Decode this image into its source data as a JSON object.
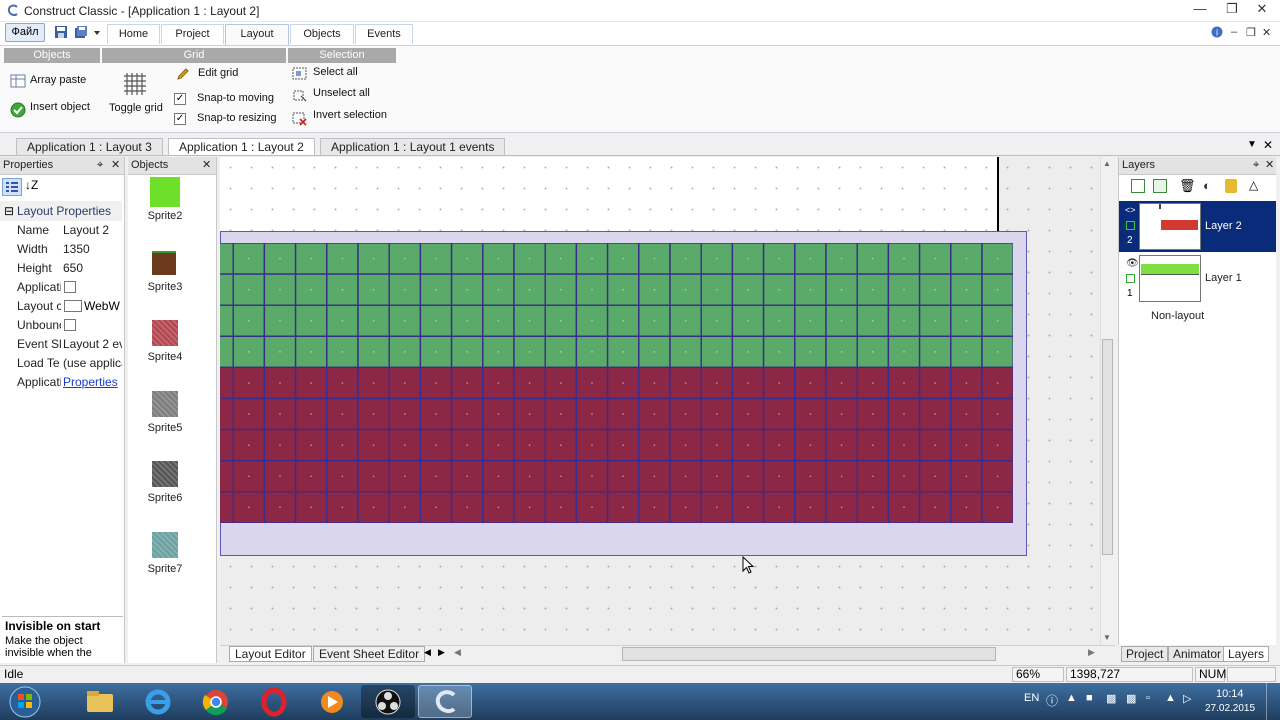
{
  "window": {
    "title": "Construct Classic - [Application 1 : Layout 2]"
  },
  "ribbon": {
    "file_label": "Файл",
    "tabs": [
      "Home",
      "Project",
      "Layout",
      "Objects",
      "Events"
    ],
    "active_tab": "Layout",
    "groups": {
      "objects": {
        "title": "Objects",
        "array_paste": "Array paste",
        "insert_object": "Insert object"
      },
      "grid": {
        "title": "Grid",
        "toggle_grid": "Toggle grid",
        "edit_grid": "Edit grid",
        "snap_moving": "Snap-to moving",
        "snap_resizing": "Snap-to resizing"
      },
      "selection": {
        "title": "Selection",
        "select_all": "Select all",
        "unselect_all": "Unselect all",
        "invert_selection": "Invert selection"
      }
    }
  },
  "doc_tabs": [
    "Application 1 : Layout 3",
    "Application 1 : Layout 2",
    "Application 1 : Layout 1 events"
  ],
  "properties": {
    "title": "Properties",
    "section": "Layout Properties",
    "rows": [
      {
        "key": "Name",
        "value": "Layout 2"
      },
      {
        "key": "Width",
        "value": "1350"
      },
      {
        "key": "Height",
        "value": "650"
      },
      {
        "key": "Applicati",
        "value": ""
      },
      {
        "key": "Layout c",
        "value": "WebW"
      },
      {
        "key": "Unbounc",
        "value": ""
      },
      {
        "key": "Event Sl",
        "value": "Layout 2 ev"
      },
      {
        "key": "Load Te",
        "value": "(use applica"
      },
      {
        "key": "Applicati",
        "value": "Properties"
      }
    ],
    "help_title": "Invisible on start",
    "help_text": "Make the object invisible when the"
  },
  "objects_panel": {
    "title": "Objects",
    "items": [
      {
        "name": "Sprite2",
        "color": "#6fe02a"
      },
      {
        "name": "Sprite3",
        "color": "#6b3a1f"
      },
      {
        "name": "Sprite4",
        "color": "#b3454f"
      },
      {
        "name": "Sprite5",
        "color": "#7d7d7d"
      },
      {
        "name": "Sprite6",
        "color": "#555555"
      },
      {
        "name": "Sprite7",
        "color": "#6aa0a0"
      }
    ]
  },
  "editor": {
    "tiles": {
      "green": "#5aaa69",
      "red": "#8c2846",
      "border": "#3a2c8c",
      "green_rows": 4,
      "red_rows": 5,
      "cols": 26
    },
    "bottom_tabs": [
      "Layout Editor",
      "Event Sheet Editor"
    ]
  },
  "layers": {
    "title": "Layers",
    "items": [
      {
        "name": "Layer 2",
        "index": "2",
        "selected": true,
        "thumb_color": "#d03a30"
      },
      {
        "name": "Layer 1",
        "index": "1",
        "selected": false,
        "thumb_color": "#7ee040"
      }
    ],
    "non_layout": "Non-layout",
    "bottom_tabs": [
      "Project",
      "Animator",
      "Layers"
    ]
  },
  "status": {
    "text": "Idle",
    "zoom": "66%",
    "coords": "1398,727",
    "num": "NUM"
  },
  "taskbar": {
    "lang": "EN",
    "time": "10:14",
    "date": "27.02.2015"
  },
  "colors": {
    "selection_blue": "#0a2a7a",
    "ribbon_group_head": "#a9a9a9"
  }
}
